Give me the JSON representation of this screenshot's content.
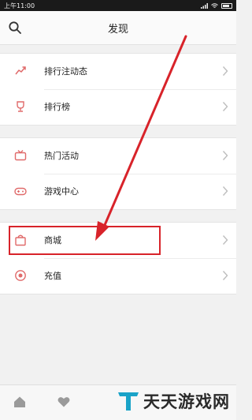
{
  "status_bar": {
    "time": "上午11:00",
    "battery": ""
  },
  "header": {
    "title": "发现",
    "search_icon": "search-icon"
  },
  "sections": [
    {
      "items": [
        {
          "label": "排行注动态",
          "icon": "trend-icon"
        },
        {
          "label": "排行榜",
          "icon": "trophy-icon"
        }
      ]
    },
    {
      "items": [
        {
          "label": "热门活动",
          "icon": "tv-icon"
        },
        {
          "label": "游戏中心",
          "icon": "gamepad-icon"
        }
      ]
    },
    {
      "items": [
        {
          "label": "商城",
          "icon": "shop-bag-icon"
        },
        {
          "label": "充值",
          "icon": "coin-icon"
        }
      ]
    }
  ],
  "accent_color": "#d8232a",
  "icon_color": "#e06a6a",
  "watermark": {
    "text": "天天游戏网",
    "logo": "letter-t-logo"
  },
  "bottom_tabs": [
    {
      "icon": "home-icon"
    },
    {
      "icon": "heart-icon"
    }
  ]
}
